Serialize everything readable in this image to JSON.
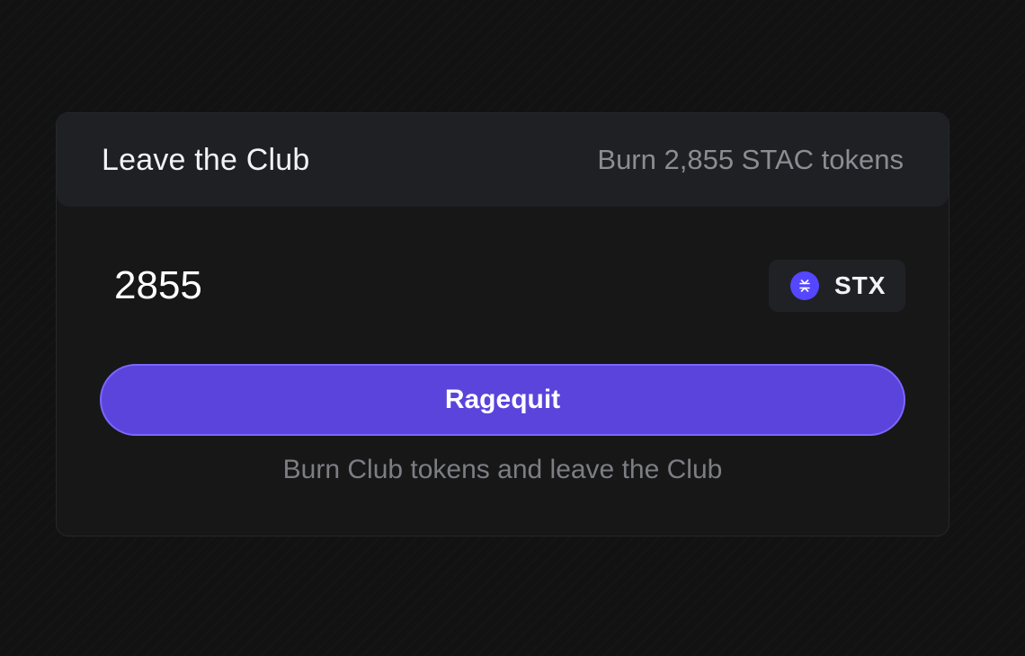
{
  "card": {
    "title": "Leave the Club",
    "subtitle": "Burn 2,855 STAC tokens"
  },
  "amount": {
    "value": "2855"
  },
  "token": {
    "symbol": "STX",
    "icon": "stacks-icon",
    "icon_color": "#5546ff"
  },
  "action": {
    "button_label": "Ragequit",
    "button_color": "#5a44dc",
    "hint": "Burn Club tokens and leave the Club"
  }
}
